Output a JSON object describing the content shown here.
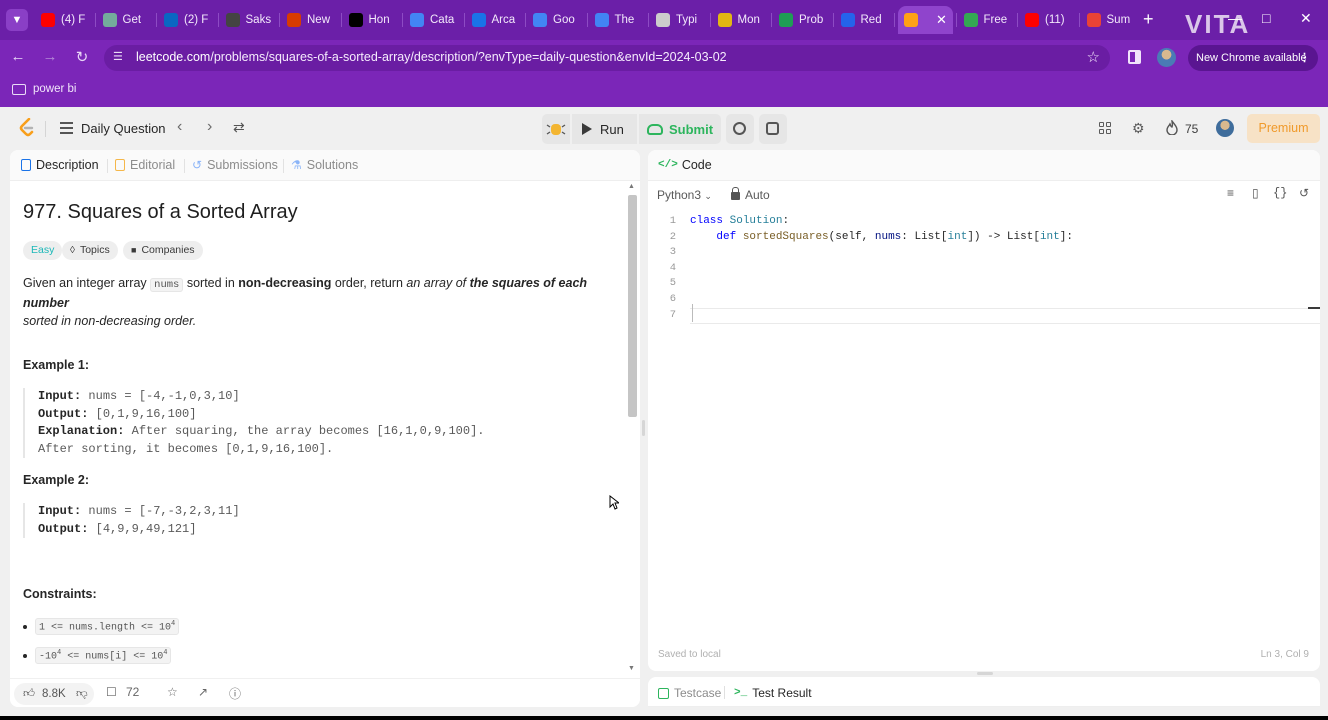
{
  "browser": {
    "tabs": [
      {
        "label": "(4) F",
        "icon": "youtube-icon",
        "color": "#ff0000"
      },
      {
        "label": "Get",
        "icon": "chatgpt-icon",
        "color": "#74aa9c"
      },
      {
        "label": "(2) F",
        "icon": "linkedin-icon",
        "color": "#0a66c2"
      },
      {
        "label": "Saks",
        "icon": "saks-icon",
        "color": "#444444"
      },
      {
        "label": "New",
        "icon": "new-icon",
        "color": "#d83b01"
      },
      {
        "label": "Hon",
        "icon": "x-icon",
        "color": "#000000"
      },
      {
        "label": "Cata",
        "icon": "cloud-icon",
        "color": "#4285f4"
      },
      {
        "label": "Arca",
        "icon": "arcade-icon",
        "color": "#1a73e8"
      },
      {
        "label": "Goo",
        "icon": "google-cloud-icon",
        "color": "#4285f4"
      },
      {
        "label": "The",
        "icon": "cloud-icon",
        "color": "#4285f4"
      },
      {
        "label": "Typi",
        "icon": "typing-icon",
        "color": "#cccccc"
      },
      {
        "label": "Mon",
        "icon": "monkeytype-icon",
        "color": "#e2b714"
      },
      {
        "label": "Prob",
        "icon": "problem-icon",
        "color": "#1f9d55"
      },
      {
        "label": "Red",
        "icon": "red-icon",
        "color": "#2563eb"
      },
      {
        "label": "",
        "icon": "leetcode-icon",
        "color": "#ffa116",
        "active": true
      },
      {
        "label": "Free",
        "icon": "free-icon",
        "color": "#34a853"
      },
      {
        "label": "(11)",
        "icon": "youtube-icon",
        "color": "#ff0000"
      },
      {
        "label": "Sum",
        "icon": "gmail-icon",
        "color": "#ea4335"
      }
    ],
    "watermark": "VITA",
    "url_domain": "leetcode.com",
    "url_path": "/problems/squares-of-a-sorted-array/description/?envType=daily-question&envId=2024-03-02",
    "update_label": "New Chrome available",
    "bookmark": "power bi"
  },
  "lcnav": {
    "daily_label": "Daily Question",
    "run_label": "Run",
    "submit_label": "Submit",
    "fire_count": "75",
    "premium_label": "Premium"
  },
  "left_tabs": {
    "description": "Description",
    "editorial": "Editorial",
    "submissions": "Submissions",
    "solutions": "Solutions"
  },
  "problem": {
    "title": "977. Squares of a Sorted Array",
    "difficulty": "Easy",
    "topics": "Topics",
    "companies": "Companies",
    "desc_1": "Given an integer array ",
    "desc_code": "nums",
    "desc_2": " sorted in ",
    "desc_bold_1": "non-decreasing",
    "desc_3": " order, return ",
    "desc_italic": "an array of ",
    "desc_bold_italic": "the squares of each number",
    "desc_4": "sorted in non-decreasing order.",
    "ex1_title": "Example 1:",
    "ex1_input_label": "Input:",
    "ex1_input": " nums = [-4,-1,0,3,10]",
    "ex1_output_label": "Output:",
    "ex1_output": " [0,1,9,16,100]",
    "ex1_expl_label": "Explanation:",
    "ex1_expl": " After squaring, the array becomes [16,1,0,9,100].",
    "ex1_expl_2": "After sorting, it becomes [0,1,9,16,100].",
    "ex2_title": "Example 2:",
    "ex2_input_label": "Input:",
    "ex2_input": " nums = [-7,-3,2,3,11]",
    "ex2_output_label": "Output:",
    "ex2_output": " [4,9,9,49,121]",
    "constraints_title": "Constraints:",
    "c1_a": "1 <= nums.length <= 10",
    "c1_sup": "4",
    "c2_a": "-10",
    "c2_sup1": "4",
    "c2_b": " <= nums[i] <= 10",
    "c2_sup2": "4"
  },
  "footer": {
    "likes": "8.8K",
    "comments": "72"
  },
  "code": {
    "tab_label": "Code",
    "language": "Python3",
    "mode": "Auto",
    "line_numbers": [
      "1",
      "2",
      "3",
      "4",
      "5",
      "6",
      "7"
    ],
    "line1_kw": "class",
    "line1_cls": "Solution",
    "line1_rest": ":",
    "line2_kw": "def",
    "line2_fn": "sortedSquares",
    "line2_a": "(self, ",
    "line2_p": "nums",
    "line2_b": ": List[",
    "line2_t1": "int",
    "line2_c": "]) -> List[",
    "line2_t2": "int",
    "line2_d": "]:",
    "saved": "Saved to local",
    "position": "Ln 3, Col 9"
  },
  "test": {
    "testcase": "Testcase",
    "result": "Test Result"
  }
}
